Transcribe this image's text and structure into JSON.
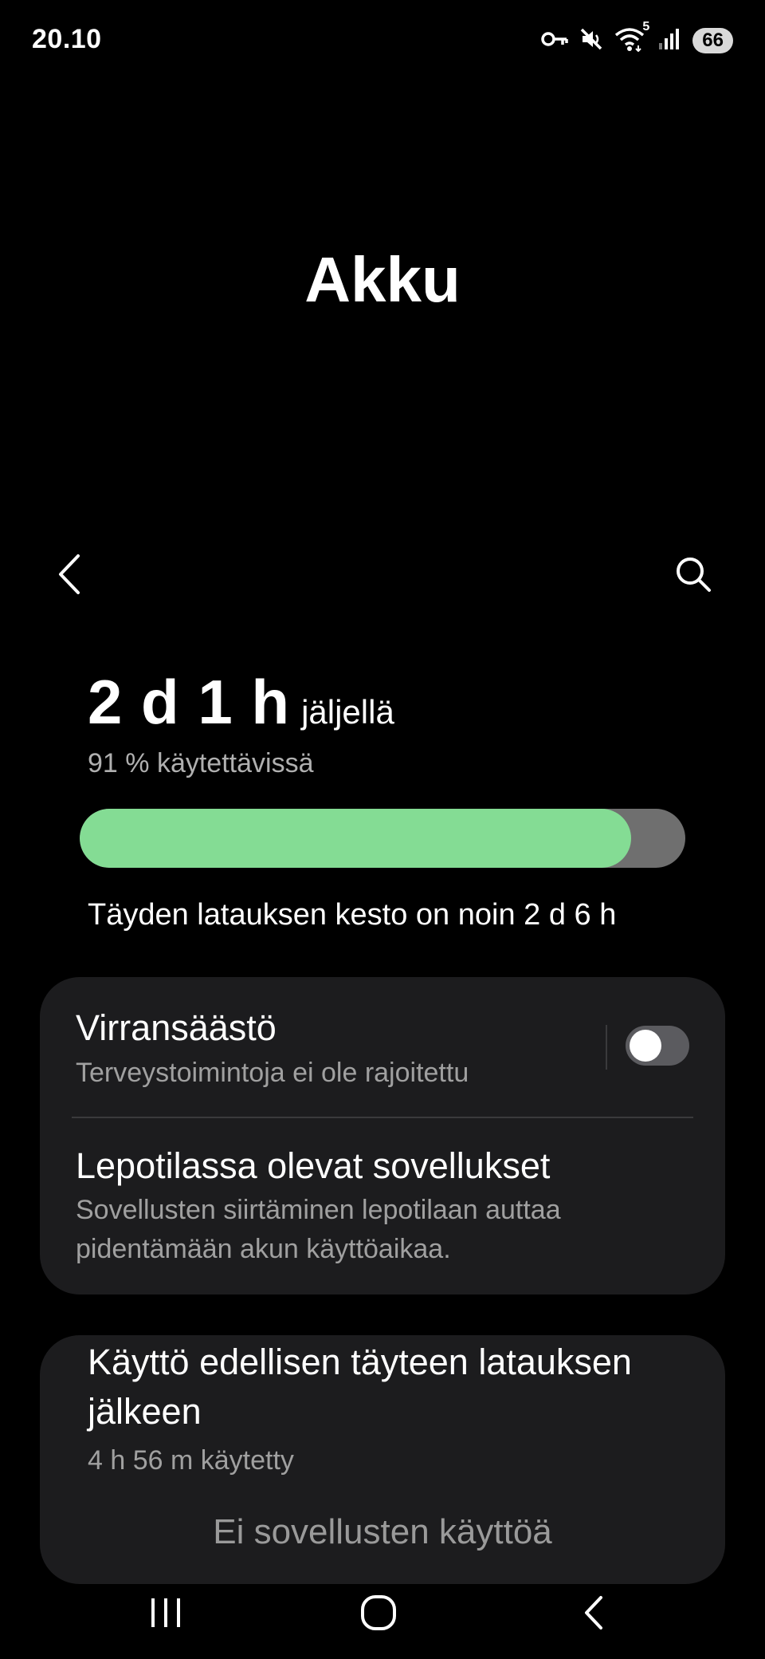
{
  "status_bar": {
    "time": "20.10",
    "icons": [
      "vpn-key-icon",
      "mute-icon",
      "wifi-icon",
      "signal-icon"
    ],
    "wifi_badge": "5",
    "battery": "66"
  },
  "page": {
    "title": "Akku"
  },
  "battery": {
    "remaining_value": "2 d 1 h",
    "remaining_suffix": "jäljellä",
    "available_text": "91 % käytettävissä",
    "level_percent": 91,
    "fill_color": "#84dc94",
    "track_color": "#6f6f6f",
    "charge_time_text": "Täyden latauksen kesto on noin 2 d 6 h"
  },
  "settings": {
    "power_saving": {
      "title": "Virransäästö",
      "subtitle": "Terveystoimintoja ei ole rajoitettu",
      "enabled": false
    },
    "sleeping_apps": {
      "title": "Lepotilassa olevat sovellukset",
      "subtitle_line1": "Sovellusten siirtäminen lepotilaan auttaa",
      "subtitle_line2": "pidentämään akun käyttöaikaa."
    }
  },
  "usage": {
    "title_line1": "Käyttö edellisen täyteen latauksen",
    "title_line2": "jälkeen",
    "used": "4 h 56 m käytetty",
    "empty_message": "Ei sovellusten käyttöä"
  },
  "navigation": [
    "recent-apps-icon",
    "home-icon",
    "back-icon"
  ]
}
